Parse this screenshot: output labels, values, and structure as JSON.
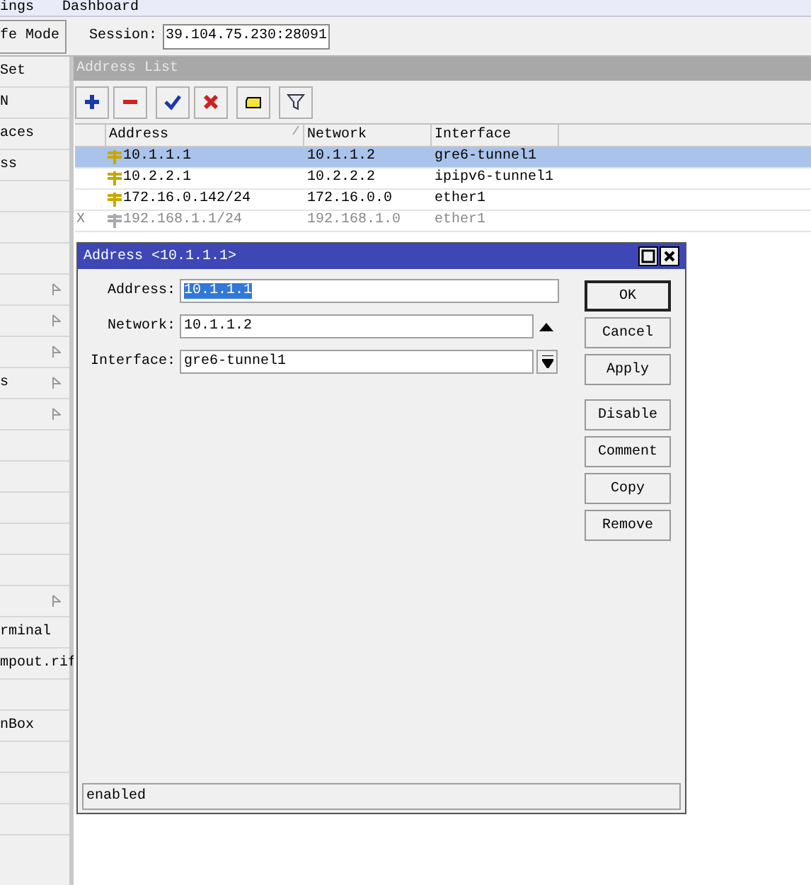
{
  "menu_bar": {
    "items": [
      "ings",
      "Dashboard"
    ]
  },
  "toolbar": {
    "mode_button": "fe Mode",
    "session_label": "Session:",
    "session_value": "39.104.75.230:28091"
  },
  "sidebar": {
    "items": [
      {
        "label": "Set",
        "submenu": false
      },
      {
        "label": "N",
        "submenu": false
      },
      {
        "label": "aces",
        "submenu": false
      },
      {
        "label": "ss",
        "submenu": false
      },
      {
        "submenu": false
      },
      {
        "submenu": false
      },
      {
        "submenu": false
      },
      {
        "submenu": true
      },
      {
        "submenu": true
      },
      {
        "submenu": true
      },
      {
        "label": "s",
        "submenu": true
      },
      {
        "submenu": true
      },
      {
        "submenu": false
      },
      {
        "submenu": false
      },
      {
        "submenu": false
      },
      {
        "submenu": false
      },
      {
        "submenu": false
      },
      {
        "submenu": true
      },
      {
        "label": "rminal",
        "submenu": false
      },
      {
        "label": "mpout.rif",
        "submenu": false
      },
      {
        "submenu": false
      },
      {
        "label": "nBox",
        "submenu": false
      },
      {
        "submenu": false
      },
      {
        "submenu": false
      },
      {
        "submenu": false
      }
    ]
  },
  "address_list": {
    "title": "Address List",
    "tools": [
      {
        "kind": "add"
      },
      {
        "kind": "remove"
      },
      {
        "kind": "enable"
      },
      {
        "kind": "disable"
      },
      {
        "kind": "comment"
      },
      {
        "kind": "filter"
      }
    ],
    "columns": [
      "Address",
      "Network",
      "Interface"
    ],
    "rows": [
      {
        "address": "10.1.1.1",
        "network": "10.1.1.2",
        "interface": "gre6-tunnel1",
        "selected": true,
        "disabled": false
      },
      {
        "address": "10.2.2.1",
        "network": "10.2.2.2",
        "interface": "ipipv6-tunnel1",
        "selected": false,
        "disabled": false
      },
      {
        "address": "172.16.0.142/24",
        "network": "172.16.0.0",
        "interface": "ether1",
        "selected": false,
        "disabled": false
      },
      {
        "flag": "X",
        "address": "192.168.1.1/24",
        "network": "192.168.1.0",
        "interface": "ether1",
        "selected": false,
        "disabled": true
      }
    ]
  },
  "dialog": {
    "title": "Address <10.1.1.1>",
    "fields": [
      {
        "label": "Address:",
        "value": "10.1.1.1",
        "kind": "text",
        "text_selected": true
      },
      {
        "label": "Network:",
        "value": "10.1.1.2",
        "kind": "collapsible",
        "text_selected": false
      },
      {
        "label": "Interface:",
        "value": "gre6-tunnel1",
        "kind": "dropdown",
        "text_selected": false
      }
    ],
    "buttons": [
      {
        "label": "OK",
        "default": true
      },
      {
        "label": "Cancel",
        "default": false
      },
      {
        "label": "Apply",
        "default": false
      },
      {
        "label": "Disable",
        "default": false
      },
      {
        "label": "Comment",
        "default": false
      },
      {
        "label": "Copy",
        "default": false
      },
      {
        "label": "Remove",
        "default": false
      }
    ],
    "status": "enabled"
  }
}
